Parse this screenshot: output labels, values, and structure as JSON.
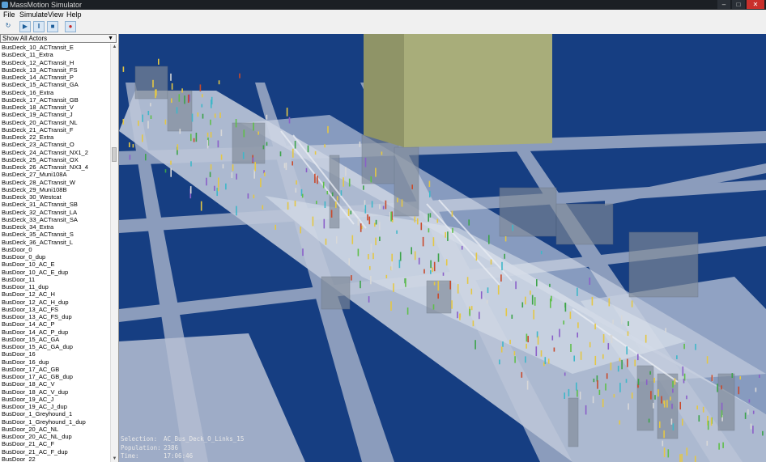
{
  "window": {
    "title": "MassMotion Simulator",
    "controls": [
      "–",
      "□",
      "✕"
    ]
  },
  "menu": {
    "items": [
      "File",
      "Simulate",
      "View",
      "Help"
    ]
  },
  "toolbar": {
    "buttons": [
      {
        "name": "reset-icon",
        "glyph": "↻"
      },
      {
        "name": "play-icon",
        "glyph": "▶"
      },
      {
        "name": "pause-icon",
        "glyph": "‖"
      },
      {
        "name": "stop-icon",
        "glyph": "■"
      },
      {
        "name": "record-icon",
        "glyph": "●"
      }
    ]
  },
  "actor_filter": {
    "selected": "Show All Actors"
  },
  "actors": [
    "BusDeck_10_ACTransit_E",
    "BusDeck_11_Extra",
    "BusDeck_12_ACTransit_H",
    "BusDeck_13_ACTransit_FS",
    "BusDeck_14_ACTransit_P",
    "BusDeck_15_ACTransit_GA",
    "BusDeck_16_Extra",
    "BusDeck_17_ACTransit_GB",
    "BusDeck_18_ACTransit_V",
    "BusDeck_19_ACTransit_J",
    "BusDeck_20_ACTransit_NL",
    "BusDeck_21_ACTransit_F",
    "BusDeck_22_Extra",
    "BusDeck_23_ACTransit_O",
    "BusDeck_24_ACTransit_NX1_2",
    "BusDeck_25_ACTransit_OX",
    "BusDeck_26_ACTransit_NX3_4",
    "BusDeck_27_Muni108A",
    "BusDeck_28_ACTransit_W",
    "BusDeck_29_Muni108B",
    "BusDeck_30_Westcat",
    "BusDeck_31_ACTransit_SB",
    "BusDeck_32_ACTransit_LA",
    "BusDeck_33_ACTransit_SA",
    "BusDeck_34_Extra",
    "BusDeck_35_ACTransit_S",
    "BusDeck_36_ACTransit_L",
    "BusDoor_0",
    "BusDoor_0_dup",
    "BusDoor_10_AC_E",
    "BusDoor_10_AC_E_dup",
    "BusDoor_11",
    "BusDoor_11_dup",
    "BusDoor_12_AC_H",
    "BusDoor_12_AC_H_dup",
    "BusDoor_13_AC_FS",
    "BusDoor_13_AC_FS_dup",
    "BusDoor_14_AC_P",
    "BusDoor_14_AC_P_dup",
    "BusDoor_15_AC_GA",
    "BusDoor_15_AC_GA_dup",
    "BusDoor_16",
    "BusDoor_16_dup",
    "BusDoor_17_AC_GB",
    "BusDoor_17_AC_GB_dup",
    "BusDoor_18_AC_V",
    "BusDoor_18_AC_V_dup",
    "BusDoor_19_AC_J",
    "BusDoor_19_AC_J_dup",
    "BusDoor_1_Greyhound_1",
    "BusDoor_1_Greyhound_1_dup",
    "BusDoor_20_AC_NL",
    "BusDoor_20_AC_NL_dup",
    "BusDoor_21_AC_F",
    "BusDoor_21_AC_F_dup",
    "BusDoor_22"
  ],
  "status": {
    "selection_label": "Selection:",
    "selection_value": "AC_Bus_Deck_O_Links_15",
    "population_label": "Population:",
    "population_value": "2386",
    "time_label": "Time:",
    "time_value": "17:06:46"
  },
  "colors": {
    "ground": "#163e82",
    "tower": "#a8ad7a",
    "platform": "#b9c3d6",
    "building": "#7c8694"
  }
}
